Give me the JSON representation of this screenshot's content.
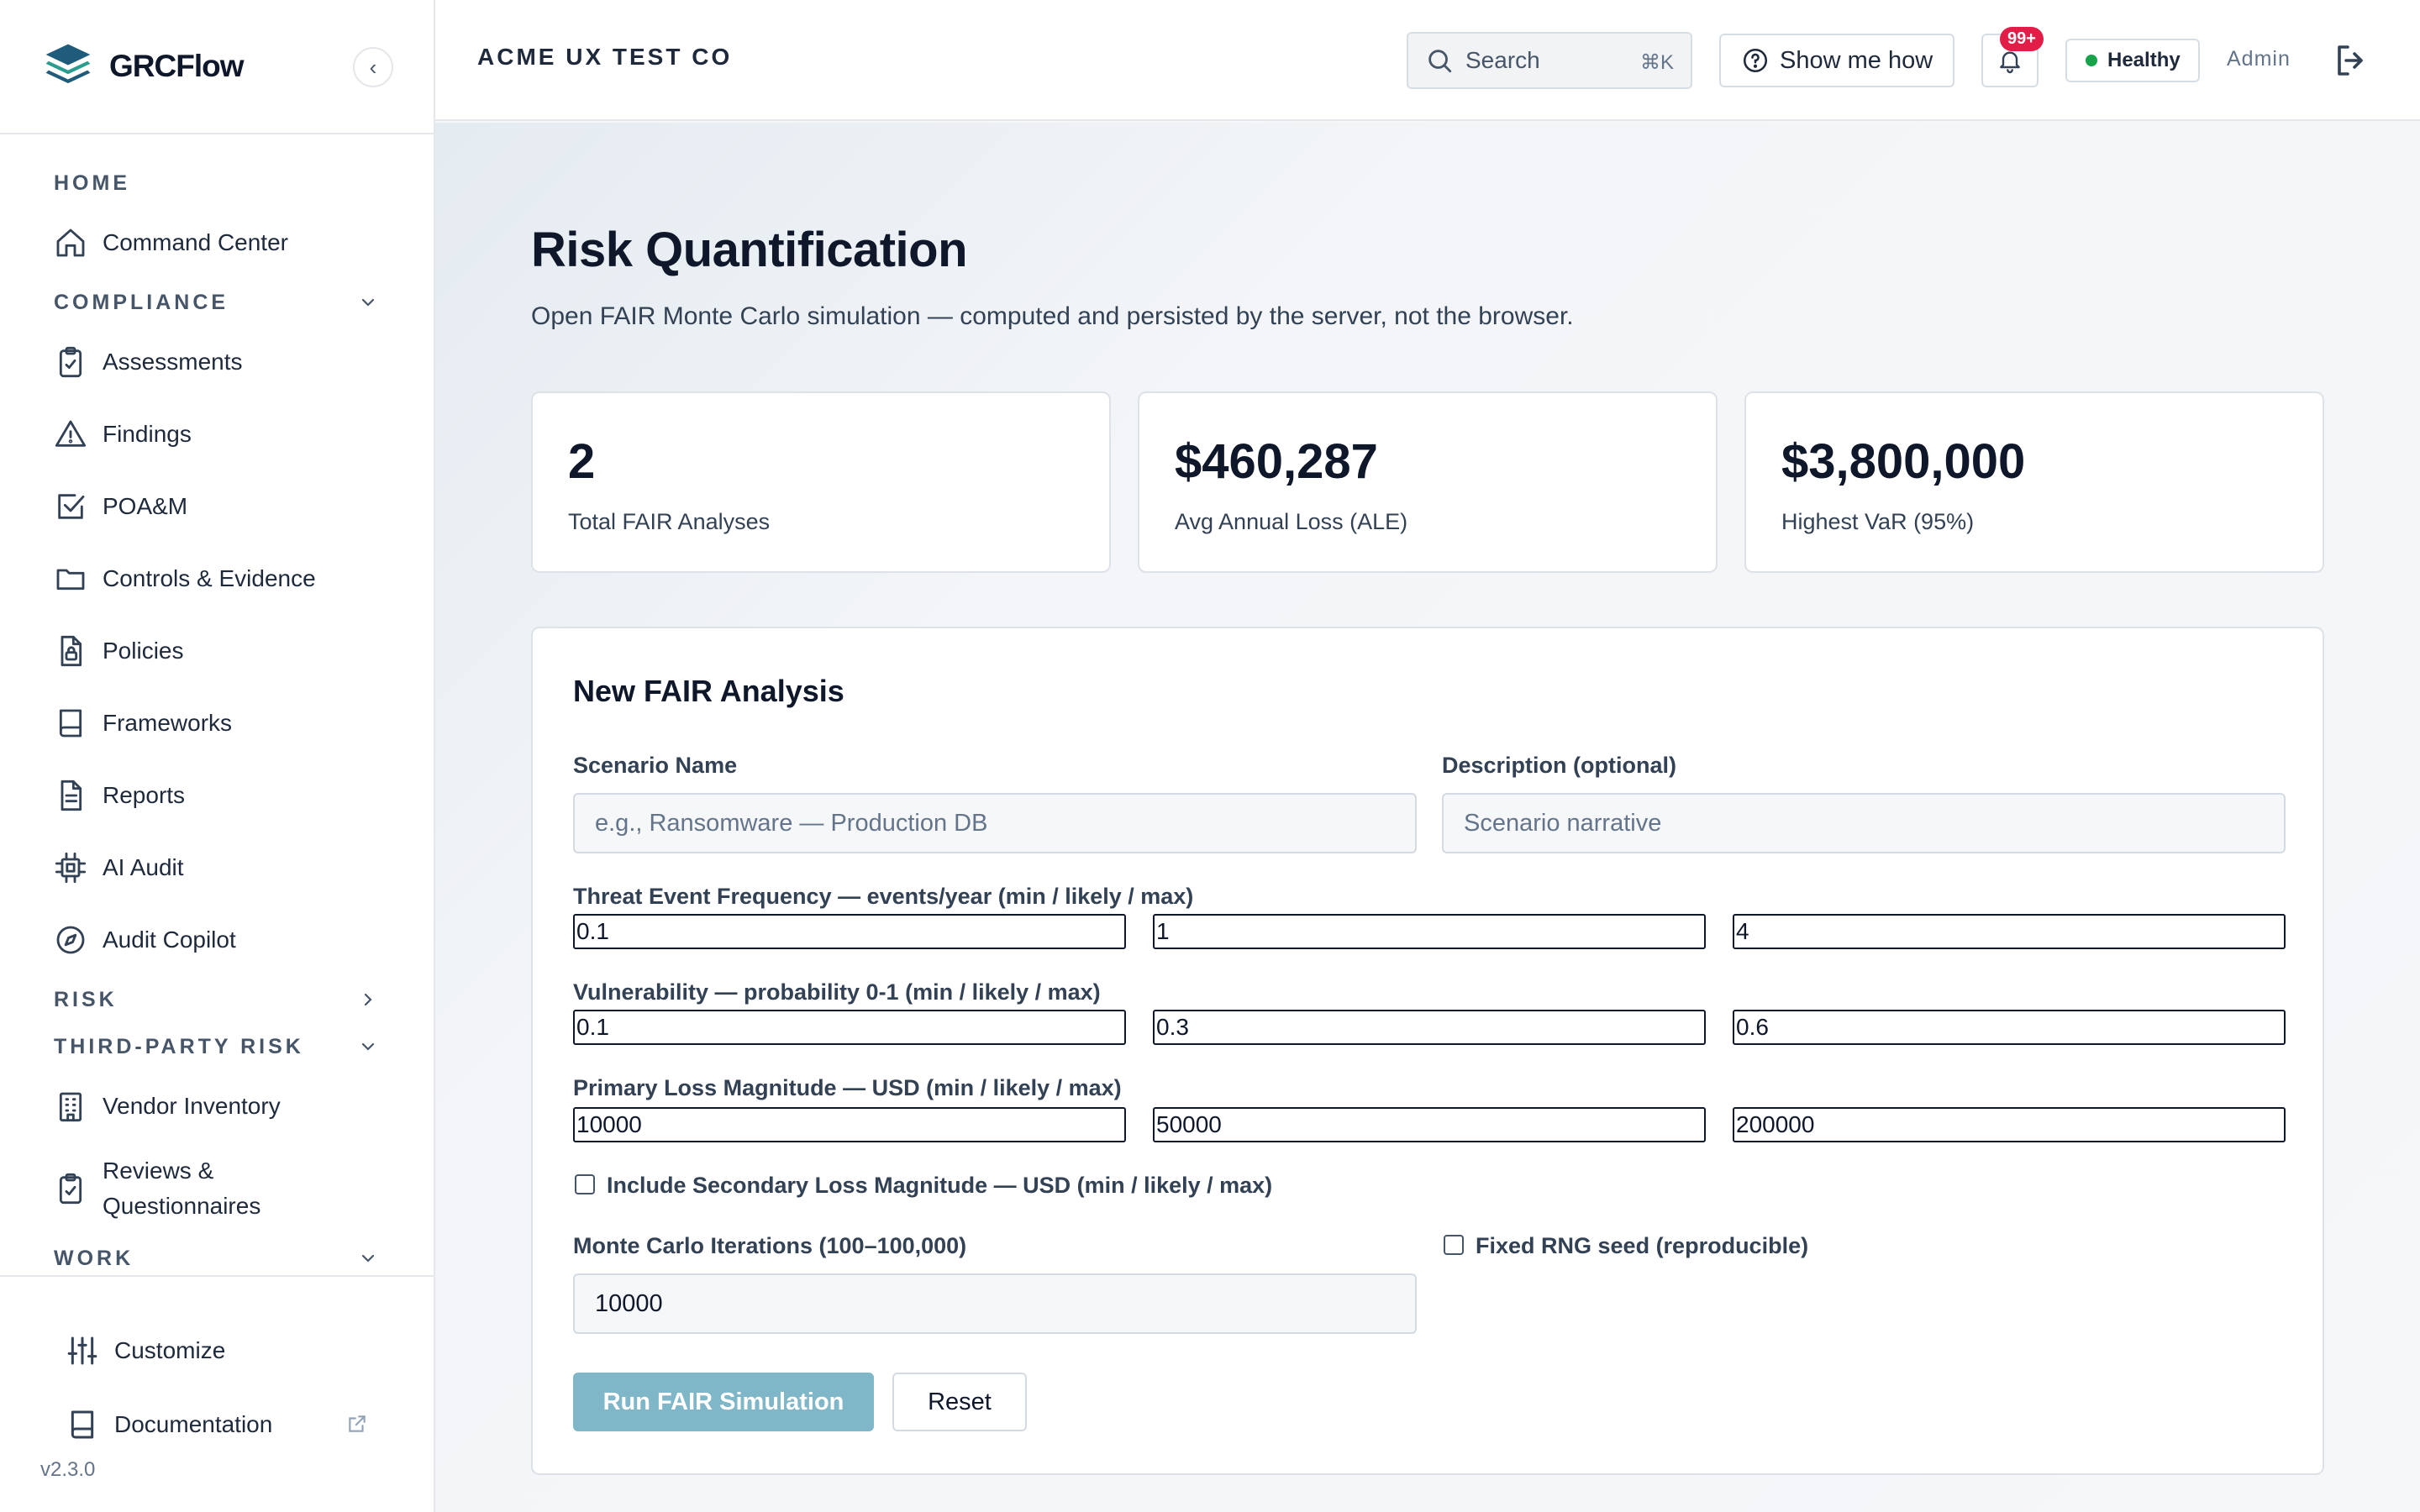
{
  "app": {
    "name": "GRCFlow",
    "version": "v2.3.0",
    "collapse_glyph": "‹"
  },
  "sidebar": {
    "sections": [
      {
        "label": "HOME",
        "expanded": null,
        "items": [
          {
            "label": "Command Center",
            "icon": "home-icon"
          }
        ]
      },
      {
        "label": "COMPLIANCE",
        "expanded": true,
        "items": [
          {
            "label": "Assessments",
            "icon": "clipboard-check-icon"
          },
          {
            "label": "Findings",
            "icon": "warning-triangle-icon"
          },
          {
            "label": "POA&M",
            "icon": "checkbox-square-icon"
          },
          {
            "label": "Controls & Evidence",
            "icon": "folder-icon"
          },
          {
            "label": "Policies",
            "icon": "document-lock-icon"
          },
          {
            "label": "Frameworks",
            "icon": "book-icon"
          },
          {
            "label": "Reports",
            "icon": "file-text-icon"
          },
          {
            "label": "AI Audit",
            "icon": "cpu-chip-icon"
          },
          {
            "label": "Audit Copilot",
            "icon": "compass-icon"
          }
        ]
      },
      {
        "label": "RISK",
        "expanded": false,
        "items": []
      },
      {
        "label": "THIRD-PARTY RISK",
        "expanded": true,
        "items": [
          {
            "label": "Vendor Inventory",
            "icon": "building-icon"
          },
          {
            "label": "Reviews & Questionnaires",
            "icon": "clipboard-check-icon"
          }
        ]
      },
      {
        "label": "WORK",
        "expanded": true,
        "items": []
      }
    ],
    "footer": {
      "customize": "Customize",
      "documentation": "Documentation"
    }
  },
  "header": {
    "org": "ACME UX TEST CO",
    "search_label": "Search",
    "search_shortcut": "⌘K",
    "show_me_how": "Show me how",
    "notif_count": "99+",
    "health": "Healthy",
    "user": "Admin"
  },
  "page": {
    "title": "Risk Quantification",
    "subtitle": "Open FAIR Monte Carlo simulation — computed and persisted by the server, not the browser."
  },
  "stats": [
    {
      "value": "2",
      "label": "Total FAIR Analyses"
    },
    {
      "value": "$460,287",
      "label": "Avg Annual Loss (ALE)"
    },
    {
      "value": "$3,800,000",
      "label": "Highest VaR (95%)"
    }
  ],
  "form": {
    "title": "New FAIR Analysis",
    "scenario_label": "Scenario Name",
    "scenario_placeholder": "e.g., Ransomware — Production DB",
    "description_label": "Description (optional)",
    "description_placeholder": "Scenario narrative",
    "tef": {
      "label": "Threat Event Frequency — events/year (min / likely / max)",
      "values": [
        "0.1",
        "1",
        "4"
      ]
    },
    "vuln": {
      "label": "Vulnerability — probability 0-1 (min / likely / max)",
      "values": [
        "0.1",
        "0.3",
        "0.6"
      ]
    },
    "plm": {
      "label": "Primary Loss Magnitude — USD (min / likely / max)",
      "values": [
        "10000",
        "50000",
        "200000"
      ]
    },
    "secondary": {
      "label": "Include Secondary Loss Magnitude — USD (min / likely / max)",
      "checked": false
    },
    "iterations_label": "Monte Carlo Iterations (100–100,000)",
    "iterations_value": "10000",
    "seed": {
      "label": "Fixed RNG seed (reproducible)",
      "checked": false
    },
    "run_label": "Run FAIR Simulation",
    "reset_label": "Reset"
  },
  "colors": {
    "accent": "#7fb6c8",
    "badge": "#e11d48",
    "healthy": "#16a34a",
    "brand": "#1f5b7a"
  }
}
